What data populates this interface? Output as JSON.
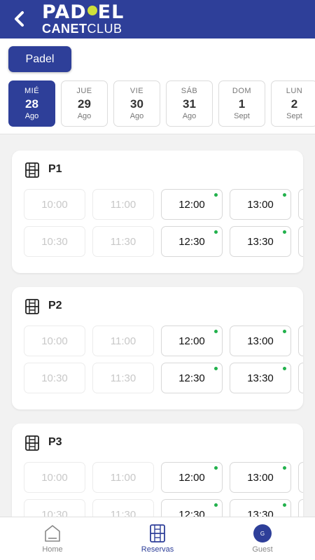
{
  "header": {
    "logo_line1_a": "PAD",
    "logo_line1_b": "EL",
    "logo_line2_bold": "CANET",
    "logo_line2_rest": "CLUB",
    "back_icon": "chevron-left-icon"
  },
  "sport_button_label": "Padel",
  "days": [
    {
      "name": "MIÉ",
      "num": "28",
      "month": "Ago"
    },
    {
      "name": "JUE",
      "num": "29",
      "month": "Ago"
    },
    {
      "name": "VIE",
      "num": "30",
      "month": "Ago"
    },
    {
      "name": "SÁB",
      "num": "31",
      "month": "Ago"
    },
    {
      "name": "DOM",
      "num": "1",
      "month": "Sept"
    },
    {
      "name": "LUN",
      "num": "2",
      "month": "Sept"
    }
  ],
  "courts": [
    {
      "name": "P1",
      "slots": [
        "10:00",
        "11:00",
        "12:00",
        "13:00",
        "10:30",
        "11:30",
        "12:30",
        "13:30"
      ]
    },
    {
      "name": "P2",
      "slots": [
        "10:00",
        "11:00",
        "12:00",
        "13:00",
        "10:30",
        "11:30",
        "12:30",
        "13:30"
      ]
    },
    {
      "name": "P3",
      "slots": [
        "10:00",
        "11:00",
        "12:00",
        "13:00",
        "10:30",
        "11:30",
        "12:30",
        "13:30"
      ]
    }
  ],
  "nav": {
    "home": "Home",
    "reservas": "Reservas",
    "guest": "Guest",
    "avatar_initial": "G"
  },
  "colors": {
    "primary": "#2e3f99",
    "available_dot": "#22b14c",
    "logo_ball": "#cfe03a"
  }
}
